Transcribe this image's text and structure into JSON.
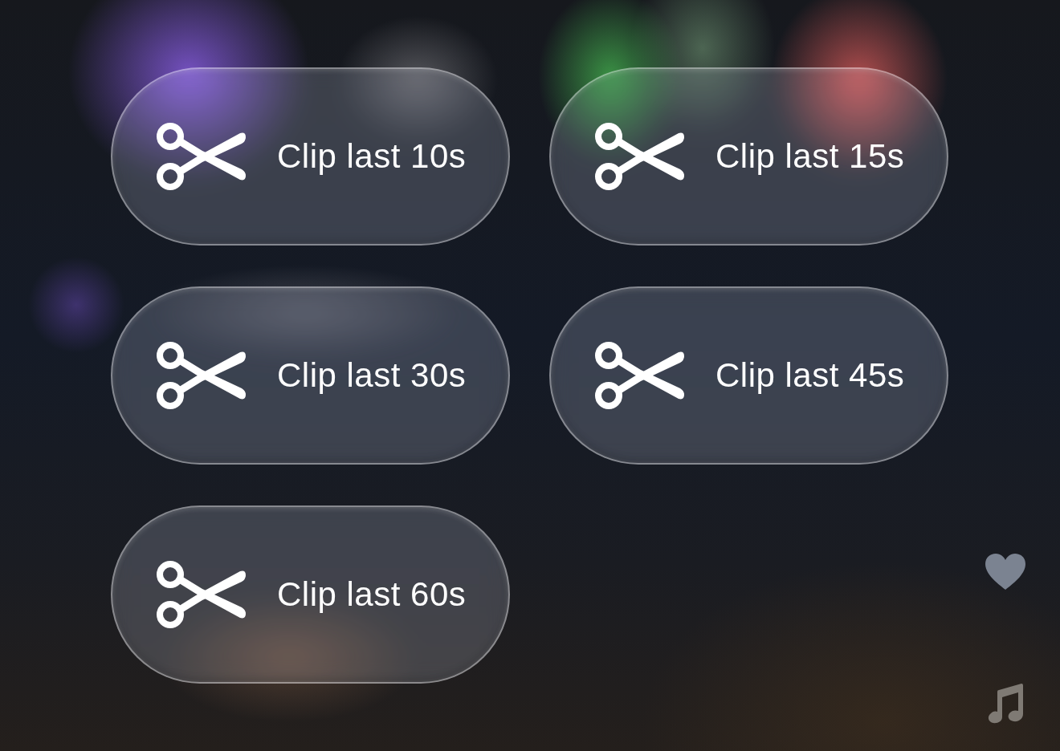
{
  "clip_buttons": [
    {
      "label": "Clip last 10s"
    },
    {
      "label": "Clip last 15s"
    },
    {
      "label": "Clip last 30s"
    },
    {
      "label": "Clip last 45s"
    },
    {
      "label": "Clip last 60s"
    }
  ]
}
